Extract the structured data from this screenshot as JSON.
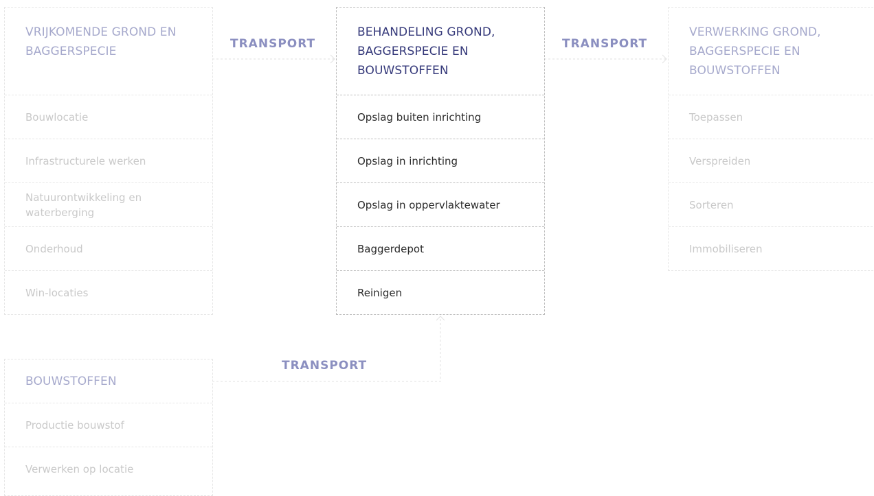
{
  "columns": {
    "vrijkomende": {
      "title": "VRIJKOMENDE GROND EN BAGGERSPECIE",
      "items": [
        "Bouwlocatie",
        "Infrastructurele werken",
        "Natuurontwikkeling en waterberging",
        "Onderhoud",
        "Win-locaties"
      ]
    },
    "behandeling": {
      "title": "BEHANDELING GROND, BAGGERSPECIE EN BOUWSTOFFEN",
      "items": [
        "Opslag buiten inrichting",
        "Opslag in inrichting",
        "Opslag in oppervlaktewater",
        "Baggerdepot",
        "Reinigen"
      ]
    },
    "verwerking": {
      "title": "VERWERKING GROND, BAGGERSPECIE EN BOUWSTOFFEN",
      "items": [
        "Toepassen",
        "Verspreiden",
        "Sorteren",
        "Immobiliseren"
      ]
    },
    "bouwstoffen": {
      "title": "BOUWSTOFFEN",
      "items": [
        "Productie bouwstof",
        "Verwerken op locatie"
      ]
    }
  },
  "transport_labels": [
    "TRANSPORT",
    "TRANSPORT",
    "TRANSPORT"
  ],
  "colors": {
    "accent": "#35397a",
    "muted_title": "#a6a9cc",
    "transport": "#8b8fc0",
    "muted_item": "#c9c9c9"
  }
}
